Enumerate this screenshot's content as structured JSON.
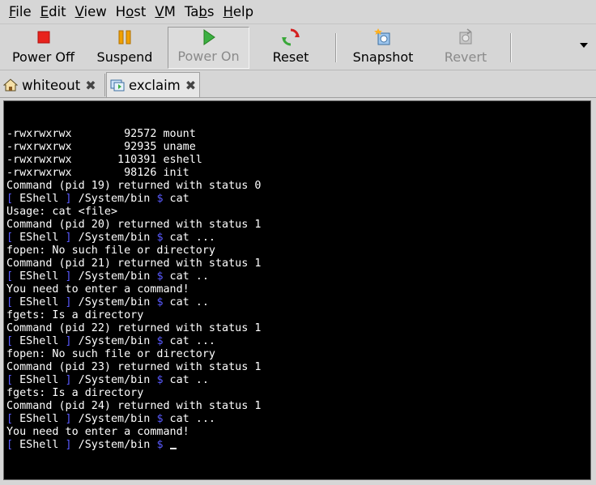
{
  "menu": [
    {
      "pre": "",
      "ul": "F",
      "post": "ile"
    },
    {
      "pre": "",
      "ul": "E",
      "post": "dit"
    },
    {
      "pre": "",
      "ul": "V",
      "post": "iew"
    },
    {
      "pre": "H",
      "ul": "o",
      "post": "st"
    },
    {
      "pre": "",
      "ul": "V",
      "post": "M"
    },
    {
      "pre": "Ta",
      "ul": "b",
      "post": "s"
    },
    {
      "pre": "",
      "ul": "H",
      "post": "elp"
    }
  ],
  "toolbar": {
    "power_off": "Power Off",
    "suspend": "Suspend",
    "power_on": "Power On",
    "reset": "Reset",
    "snapshot": "Snapshot",
    "revert": "Revert"
  },
  "tabs": [
    {
      "label": "whiteout",
      "icon": "home-icon"
    },
    {
      "label": "exclaim",
      "icon": "vm-icon"
    }
  ],
  "console": {
    "prompt_open": "[ ",
    "prompt_name": "EShell",
    "prompt_close": " ]",
    "path": " /System/bin ",
    "dollar": "$",
    "lines": [
      {
        "text": "-rwxrwxrwx        92572 mount"
      },
      {
        "text": "-rwxrwxrwx        92935 uname"
      },
      {
        "text": "-rwxrwxrwx       110391 eshell"
      },
      {
        "text": "-rwxrwxrwx        98126 init"
      },
      {
        "text": "Command (pid 19) returned with status 0"
      },
      {
        "prompt": true,
        "cmd": " cat"
      },
      {
        "text": "Usage: cat <file>"
      },
      {
        "text": "Command (pid 20) returned with status 1"
      },
      {
        "prompt": true,
        "cmd": " cat ..."
      },
      {
        "text": "fopen: No such file or directory"
      },
      {
        "text": "Command (pid 21) returned with status 1"
      },
      {
        "prompt": true,
        "cmd": " cat .."
      },
      {
        "text": "You need to enter a command!"
      },
      {
        "prompt": true,
        "cmd": " cat .."
      },
      {
        "text": "fgets: Is a directory"
      },
      {
        "text": "Command (pid 22) returned with status 1"
      },
      {
        "prompt": true,
        "cmd": " cat ..."
      },
      {
        "text": "fopen: No such file or directory"
      },
      {
        "text": "Command (pid 23) returned with status 1"
      },
      {
        "prompt": true,
        "cmd": " cat .."
      },
      {
        "text": "fgets: Is a directory"
      },
      {
        "text": "Command (pid 24) returned with status 1"
      },
      {
        "prompt": true,
        "cmd": " cat ..."
      },
      {
        "text": "You need to enter a command!"
      },
      {
        "prompt": true,
        "cmd": " ",
        "cursor": true
      }
    ]
  },
  "colors": {
    "prompt_accent": "#5a5aff",
    "console_bg": "#000000",
    "console_fg": "#ffffff",
    "chrome_bg": "#d6d6d6"
  }
}
